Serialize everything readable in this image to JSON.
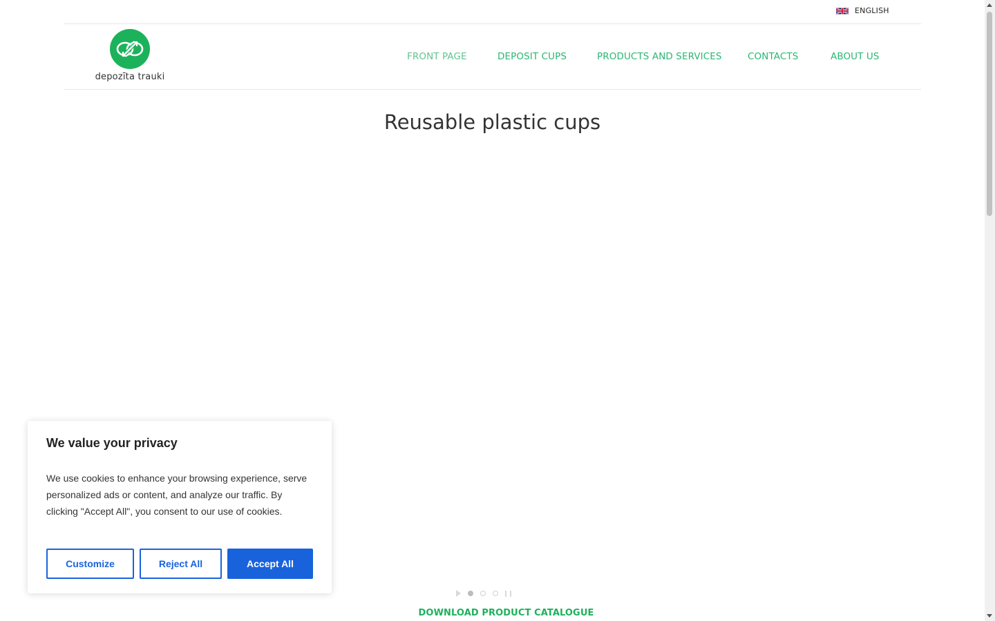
{
  "language": {
    "label": "ENGLISH",
    "flag_icon": "uk-flag-icon"
  },
  "logo": {
    "text": "depozīta trauki",
    "color": "#1cb25b"
  },
  "nav": {
    "items": [
      {
        "label": "FRONT PAGE",
        "active": true
      },
      {
        "label": "DEPOSIT CUPS"
      },
      {
        "label": "PRODUCTS AND SERVICES"
      },
      {
        "label": "CONTACTS"
      },
      {
        "label": "ABOUT US"
      }
    ],
    "color": "#2bb673"
  },
  "page": {
    "title": "Reusable plastic cups"
  },
  "slider": {
    "slides": 3,
    "active_slide": 1
  },
  "catalogue_link": "DOWNLOAD PRODUCT CATALOGUE",
  "cookie_banner": {
    "title": "We value your privacy",
    "body": "We use cookies to enhance your browsing experience, serve personalized ads or content, and analyze our traffic. By clicking \"Accept All\", you consent to our use of cookies.",
    "buttons": {
      "customize": "Customize",
      "reject": "Reject All",
      "accept": "Accept All"
    },
    "accent_color": "#1863dc"
  }
}
